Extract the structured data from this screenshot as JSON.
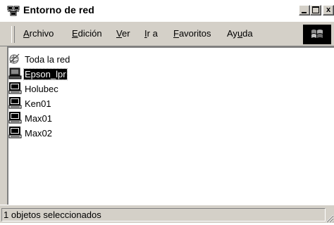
{
  "window": {
    "title": "Entorno de red"
  },
  "title_controls": {
    "minimize": "_",
    "maximize": "□",
    "close": "x"
  },
  "menu": {
    "items": [
      {
        "label": "Archivo",
        "accesskey": "A"
      },
      {
        "label": "Edición",
        "accesskey": "E"
      },
      {
        "label": "Ver",
        "accesskey": "V"
      },
      {
        "label": "Ir a",
        "accesskey": "I"
      },
      {
        "label": "Favoritos",
        "accesskey": "F"
      },
      {
        "label": "Ayuda",
        "accesskey": "u"
      }
    ]
  },
  "network_items": [
    {
      "label": "Toda la red",
      "icon": "globe-icon",
      "selected": false
    },
    {
      "label": "Epson_lpr",
      "icon": "computer-icon",
      "selected": true
    },
    {
      "label": "Holubec",
      "icon": "computer-icon",
      "selected": false
    },
    {
      "label": "Ken01",
      "icon": "computer-icon",
      "selected": false
    },
    {
      "label": "Max01",
      "icon": "computer-icon",
      "selected": false
    },
    {
      "label": "Max02",
      "icon": "computer-icon",
      "selected": false
    }
  ],
  "status": {
    "text": "1 objetos seleccionados"
  },
  "colors": {
    "chrome": "#d4d0c8",
    "selection": "#000000",
    "content_bg": "#ffffff"
  }
}
